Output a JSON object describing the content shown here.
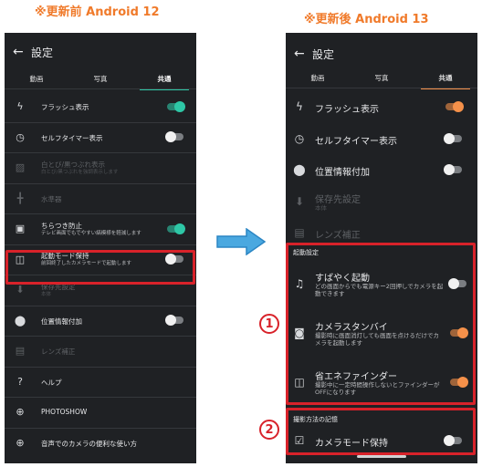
{
  "captions": {
    "before": "※更新前 Android 12",
    "after": "※更新後 Android 13"
  },
  "colors": {
    "accent_before": "#2ec7a6",
    "accent_after": "#f5914a",
    "highlight": "#d8222a",
    "caption": "#f07a2a",
    "arrow": "#4aa8e0"
  },
  "left": {
    "back": "←",
    "title": "設定",
    "tabs": [
      "動画",
      "写真",
      "共通"
    ],
    "rows": [
      {
        "icon": "flash-icon",
        "glyph": "ϟ",
        "label": "フラッシュ表示",
        "sub": "",
        "toggle": "on",
        "dim": false
      },
      {
        "icon": "self-timer-icon",
        "glyph": "◷",
        "label": "セルフタイマー表示",
        "sub": "",
        "toggle": "off",
        "dim": false
      },
      {
        "icon": "hatch-icon",
        "glyph": "▨",
        "label": "白とび/黒つぶれ表示",
        "sub": "白とび/黒つぶれを強調表示します",
        "toggle": "",
        "dim": true
      },
      {
        "icon": "level-icon",
        "glyph": "╋",
        "label": "水準器",
        "sub": "",
        "toggle": "",
        "dim": true
      },
      {
        "icon": "flicker-icon",
        "glyph": "▣",
        "label": "ちらつき防止",
        "sub": "テレビ画面でもでやすい縞模様を軽減します",
        "toggle": "on",
        "dim": false
      },
      {
        "icon": "startup-mode-icon",
        "glyph": "◫",
        "label": "起動モード保持",
        "sub": "前回終了したカメラモードで起動します",
        "toggle": "off",
        "dim": false
      },
      {
        "icon": "download-icon",
        "glyph": "⬇",
        "label": "保存先設定",
        "sub": "本体",
        "toggle": "",
        "dim": true
      },
      {
        "icon": "location-icon",
        "glyph": "⬤",
        "label": "位置情報付加",
        "sub": "",
        "toggle": "off",
        "dim": false
      },
      {
        "icon": "lens-icon",
        "glyph": "▤",
        "label": "レンズ補正",
        "sub": "",
        "toggle": "",
        "dim": true
      },
      {
        "icon": "help-icon",
        "glyph": "?",
        "label": "ヘルプ",
        "sub": "",
        "toggle": "",
        "dim": false
      },
      {
        "icon": "globe-icon",
        "glyph": "⊕",
        "label": "PHOTOSHOW",
        "sub": "",
        "toggle": "",
        "dim": false
      },
      {
        "icon": "globe-icon-2",
        "glyph": "⊕",
        "label": "音声でのカメラの便利な使い方",
        "sub": "",
        "toggle": "",
        "dim": false
      }
    ]
  },
  "right": {
    "back": "←",
    "title": "設定",
    "tabs": [
      "動画",
      "写真",
      "共通"
    ],
    "rows": [
      {
        "icon": "flash-icon",
        "glyph": "ϟ",
        "label": "フラッシュ表示",
        "sub": "",
        "toggle": "on",
        "dim": false
      },
      {
        "icon": "self-timer-icon",
        "glyph": "◷",
        "label": "セルフタイマー表示",
        "sub": "",
        "toggle": "off",
        "dim": false
      },
      {
        "icon": "location-icon",
        "glyph": "⬤",
        "label": "位置情報付加",
        "sub": "",
        "toggle": "off",
        "dim": false
      },
      {
        "icon": "download-icon",
        "glyph": "⬇",
        "label": "保存先設定",
        "sub": "本体",
        "toggle": "",
        "dim": true
      },
      {
        "icon": "lens-icon",
        "glyph": "▤",
        "label": "レンズ補正",
        "sub": "",
        "toggle": "",
        "dim": true
      }
    ],
    "section1": "起動設定",
    "startup_rows": [
      {
        "icon": "quick-launch-icon",
        "glyph": "♫",
        "label": "すばやく起動",
        "sub": "どの画面からでも電源キー2回押しでカメラを起動できます",
        "toggle": "off"
      },
      {
        "icon": "camera-icon",
        "glyph": "◙",
        "label": "カメラスタンバイ",
        "sub": "撮影時に画面消灯しても画面を点けるだけでカメラを起動します",
        "toggle": "on"
      },
      {
        "icon": "eco-finder-icon",
        "glyph": "◫",
        "label": "省エネファインダー",
        "sub": "撮影中に一定時間操作しないとファインダーがOFFになります",
        "toggle": "on"
      }
    ],
    "section2": "撮影方法の記憶",
    "memory_row": {
      "icon": "check-icon",
      "glyph": "☑",
      "label": "カメラモード保持",
      "sub": "",
      "toggle": "off"
    }
  },
  "badges": [
    "1",
    "2"
  ]
}
